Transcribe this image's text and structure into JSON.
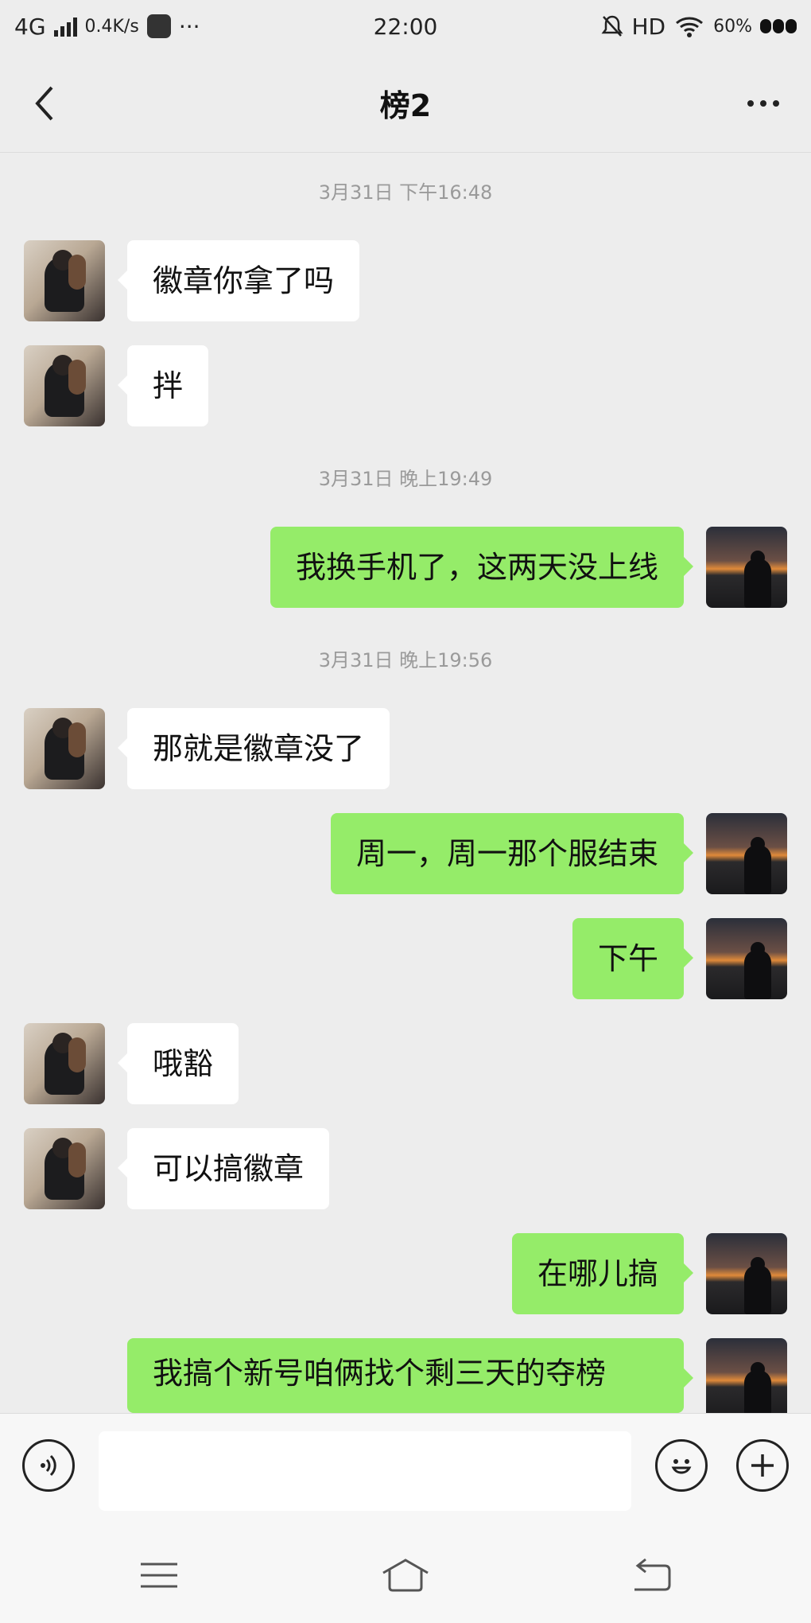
{
  "status_bar": {
    "network": "4G",
    "speed": "0.4K/s",
    "more": "···",
    "time": "22:00",
    "hd": "HD",
    "battery": "60%"
  },
  "header": {
    "title": "榜2"
  },
  "messages": [
    {
      "type": "timestamp",
      "text": "3月31日 下午16:48"
    },
    {
      "type": "msg",
      "side": "left",
      "text": "徽章你拿了吗"
    },
    {
      "type": "msg",
      "side": "left",
      "text": "拌"
    },
    {
      "type": "timestamp",
      "text": "3月31日 晚上19:49"
    },
    {
      "type": "msg",
      "side": "right",
      "text": "我换手机了，这两天没上线"
    },
    {
      "type": "timestamp",
      "text": "3月31日 晚上19:56"
    },
    {
      "type": "msg",
      "side": "left",
      "text": "那就是徽章没了"
    },
    {
      "type": "msg",
      "side": "right",
      "text": "周一，周一那个服结束"
    },
    {
      "type": "msg",
      "side": "right",
      "text": "下午"
    },
    {
      "type": "msg",
      "side": "left",
      "text": "哦豁"
    },
    {
      "type": "msg",
      "side": "left",
      "text": "可以搞徽章"
    },
    {
      "type": "msg",
      "side": "right",
      "text": "在哪儿搞"
    },
    {
      "type": "msg",
      "side": "right",
      "text": "我搞个新号咱俩找个剩三天的夺榜"
    }
  ],
  "input": {
    "placeholder": ""
  },
  "icons": {
    "back": "chevron-left-icon",
    "more": "more-dots-icon",
    "voice": "voice-icon",
    "emoji": "emoji-icon",
    "plus": "plus-icon",
    "menu": "menu-icon",
    "home": "home-icon",
    "system_back": "back-arrow-icon"
  },
  "colors": {
    "background": "#ededed",
    "bubble_sent": "#95ec69",
    "bubble_received": "#ffffff"
  }
}
